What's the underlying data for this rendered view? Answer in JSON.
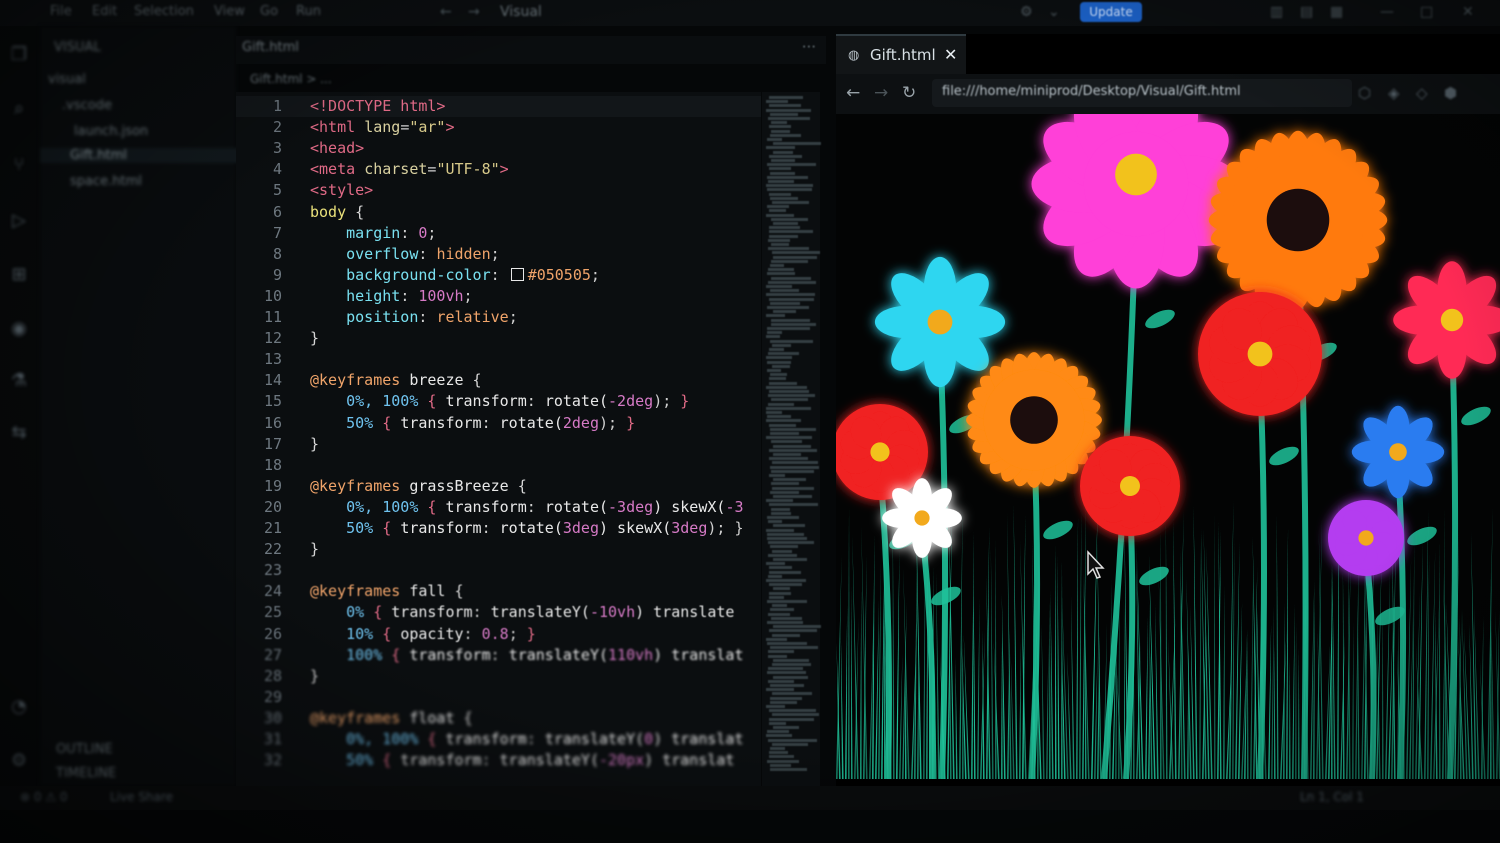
{
  "window": {
    "title": "Visual",
    "menu": [
      "File",
      "Edit",
      "Selection",
      "View",
      "Go",
      "Run"
    ],
    "update_label": "Update"
  },
  "sidebar": {
    "items": [
      {
        "label": "VISUAL"
      },
      {
        "label": "visual"
      },
      {
        "label": ".vscode"
      },
      {
        "label": "launch.json"
      },
      {
        "label": "Gift.html"
      },
      {
        "label": "space.html"
      }
    ],
    "bottom": [
      "OUTLINE",
      "TIMELINE"
    ]
  },
  "editor": {
    "tab_label": "Gift.html",
    "more_label": "···",
    "breadcrumb": "Gift.html > ...",
    "lines": [
      {
        "n": "1",
        "tokens": [
          {
            "t": "<!DOCTYPE html>",
            "c": "tag"
          }
        ]
      },
      {
        "n": "2",
        "tokens": [
          {
            "t": "<html ",
            "c": "tag"
          },
          {
            "t": "lang",
            "c": "attr"
          },
          {
            "t": "=",
            "c": "punc"
          },
          {
            "t": "\"ar\"",
            "c": "str"
          },
          {
            "t": ">",
            "c": "tag"
          }
        ]
      },
      {
        "n": "3",
        "tokens": [
          {
            "t": "<head>",
            "c": "tag"
          }
        ]
      },
      {
        "n": "4",
        "tokens": [
          {
            "t": "<meta ",
            "c": "tag"
          },
          {
            "t": "charset",
            "c": "attr"
          },
          {
            "t": "=",
            "c": "punc"
          },
          {
            "t": "\"UTF-8\"",
            "c": "str"
          },
          {
            "t": ">",
            "c": "tag"
          }
        ]
      },
      {
        "n": "5",
        "tokens": [
          {
            "t": "<style>",
            "c": "tag"
          }
        ]
      },
      {
        "n": "6",
        "tokens": [
          {
            "t": "body",
            "c": "sel"
          },
          {
            "t": " {",
            "c": "brace"
          }
        ]
      },
      {
        "n": "7",
        "tokens": [
          {
            "t": "    margin",
            "c": "prop"
          },
          {
            "t": ": ",
            "c": "punc"
          },
          {
            "t": "0",
            "c": "num"
          },
          {
            "t": ";",
            "c": "punc"
          }
        ]
      },
      {
        "n": "8",
        "tokens": [
          {
            "t": "    overflow",
            "c": "prop"
          },
          {
            "t": ": ",
            "c": "punc"
          },
          {
            "t": "hidden",
            "c": "kw"
          },
          {
            "t": ";",
            "c": "punc"
          }
        ]
      },
      {
        "n": "9",
        "tokens": [
          {
            "t": "    background-color",
            "c": "prop"
          },
          {
            "t": ": ",
            "c": "punc"
          },
          {
            "t": "",
            "c": "swatch"
          },
          {
            "t": "#050505",
            "c": "kw"
          },
          {
            "t": ";",
            "c": "punc"
          }
        ]
      },
      {
        "n": "10",
        "tokens": [
          {
            "t": "    height",
            "c": "prop"
          },
          {
            "t": ": ",
            "c": "punc"
          },
          {
            "t": "100vh",
            "c": "num"
          },
          {
            "t": ";",
            "c": "punc"
          }
        ]
      },
      {
        "n": "11",
        "tokens": [
          {
            "t": "    position",
            "c": "prop"
          },
          {
            "t": ": ",
            "c": "punc"
          },
          {
            "t": "relative",
            "c": "kw"
          },
          {
            "t": ";",
            "c": "punc"
          }
        ]
      },
      {
        "n": "12",
        "tokens": [
          {
            "t": "}",
            "c": "brace"
          }
        ]
      },
      {
        "n": "13",
        "tokens": []
      },
      {
        "n": "14",
        "tokens": [
          {
            "t": "@keyframes ",
            "c": "kw"
          },
          {
            "t": "breeze",
            "c": "val"
          },
          {
            "t": " {",
            "c": "brace"
          }
        ]
      },
      {
        "n": "15",
        "tokens": [
          {
            "t": "    0%, 100%",
            "c": "pct"
          },
          {
            "t": " { ",
            "c": "tag"
          },
          {
            "t": "transform",
            "c": "val"
          },
          {
            "t": ": ",
            "c": "punc"
          },
          {
            "t": "rotate(",
            "c": "fn"
          },
          {
            "t": "-2deg",
            "c": "num"
          },
          {
            "t": "); ",
            "c": "punc"
          },
          {
            "t": "}",
            "c": "tag"
          }
        ]
      },
      {
        "n": "16",
        "tokens": [
          {
            "t": "    50%",
            "c": "pct"
          },
          {
            "t": " { ",
            "c": "tag"
          },
          {
            "t": "transform",
            "c": "val"
          },
          {
            "t": ": ",
            "c": "punc"
          },
          {
            "t": "rotate(",
            "c": "fn"
          },
          {
            "t": "2deg",
            "c": "num"
          },
          {
            "t": "); ",
            "c": "punc"
          },
          {
            "t": "}",
            "c": "tag"
          }
        ]
      },
      {
        "n": "17",
        "tokens": [
          {
            "t": "}",
            "c": "brace"
          }
        ]
      },
      {
        "n": "18",
        "tokens": []
      },
      {
        "n": "19",
        "tokens": [
          {
            "t": "@keyframes ",
            "c": "kw"
          },
          {
            "t": "grassBreeze",
            "c": "val"
          },
          {
            "t": " {",
            "c": "brace"
          }
        ]
      },
      {
        "n": "20",
        "tokens": [
          {
            "t": "    0%, 100%",
            "c": "pct"
          },
          {
            "t": " { ",
            "c": "tag"
          },
          {
            "t": "transform",
            "c": "val"
          },
          {
            "t": ": ",
            "c": "punc"
          },
          {
            "t": "rotate(",
            "c": "fn"
          },
          {
            "t": "-3deg",
            "c": "num"
          },
          {
            "t": ") skewX(",
            "c": "fn"
          },
          {
            "t": "-3",
            "c": "num"
          }
        ]
      },
      {
        "n": "21",
        "tokens": [
          {
            "t": "    50%",
            "c": "pct"
          },
          {
            "t": " { ",
            "c": "tag"
          },
          {
            "t": "transform",
            "c": "val"
          },
          {
            "t": ": ",
            "c": "punc"
          },
          {
            "t": "rotate(",
            "c": "fn"
          },
          {
            "t": "3deg",
            "c": "num"
          },
          {
            "t": ") skewX(",
            "c": "fn"
          },
          {
            "t": "3deg",
            "c": "num"
          },
          {
            "t": "); }",
            "c": "punc"
          }
        ]
      },
      {
        "n": "22",
        "tokens": [
          {
            "t": "}",
            "c": "brace"
          }
        ]
      },
      {
        "n": "23",
        "tokens": []
      },
      {
        "n": "24",
        "tokens": [
          {
            "t": "@keyframes ",
            "c": "kw"
          },
          {
            "t": "fall",
            "c": "val"
          },
          {
            "t": " {",
            "c": "brace"
          }
        ]
      },
      {
        "n": "25",
        "tokens": [
          {
            "t": "    0%",
            "c": "pct"
          },
          {
            "t": " { ",
            "c": "tag"
          },
          {
            "t": "transform",
            "c": "val"
          },
          {
            "t": ": ",
            "c": "punc"
          },
          {
            "t": "translateY(",
            "c": "fn"
          },
          {
            "t": "-10vh",
            "c": "num"
          },
          {
            "t": ") translate",
            "c": "fn"
          }
        ]
      },
      {
        "n": "26",
        "tokens": [
          {
            "t": "    10%",
            "c": "pct"
          },
          {
            "t": " { ",
            "c": "tag"
          },
          {
            "t": "opacity",
            "c": "val"
          },
          {
            "t": ": ",
            "c": "punc"
          },
          {
            "t": "0.8",
            "c": "num"
          },
          {
            "t": "; ",
            "c": "punc"
          },
          {
            "t": "}",
            "c": "tag"
          }
        ]
      },
      {
        "n": "27",
        "tokens": [
          {
            "t": "    100%",
            "c": "pct"
          },
          {
            "t": " { ",
            "c": "tag"
          },
          {
            "t": "transform",
            "c": "val"
          },
          {
            "t": ": ",
            "c": "punc"
          },
          {
            "t": "translateY(",
            "c": "fn"
          },
          {
            "t": "110vh",
            "c": "num"
          },
          {
            "t": ") translat",
            "c": "fn"
          }
        ]
      },
      {
        "n": "28",
        "tokens": [
          {
            "t": "}",
            "c": "brace"
          }
        ]
      },
      {
        "n": "29",
        "tokens": []
      },
      {
        "n": "30",
        "tokens": [
          {
            "t": "@keyframes ",
            "c": "kw"
          },
          {
            "t": "float",
            "c": "val"
          },
          {
            "t": " {",
            "c": "brace"
          }
        ]
      },
      {
        "n": "31",
        "tokens": [
          {
            "t": "    0%, 100%",
            "c": "pct"
          },
          {
            "t": " { ",
            "c": "tag"
          },
          {
            "t": "transform",
            "c": "val"
          },
          {
            "t": ": ",
            "c": "punc"
          },
          {
            "t": "translateY(",
            "c": "fn"
          },
          {
            "t": "0",
            "c": "num"
          },
          {
            "t": ") translat",
            "c": "fn"
          }
        ]
      },
      {
        "n": "32",
        "tokens": [
          {
            "t": "    50%",
            "c": "pct"
          },
          {
            "t": " { ",
            "c": "tag"
          },
          {
            "t": "transform",
            "c": "val"
          },
          {
            "t": ": ",
            "c": "punc"
          },
          {
            "t": "translateY(",
            "c": "fn"
          },
          {
            "t": "-20px",
            "c": "num"
          },
          {
            "t": ") translat",
            "c": "fn"
          }
        ]
      }
    ]
  },
  "browser": {
    "tab_label": "Gift.html",
    "close_icon": "close-icon",
    "address": "file:///home/miniprod/Desktop/Visual/Gift.html",
    "flowers": [
      {
        "color": "#ff3fd8",
        "center": "#f2c21a",
        "kind": "daisy"
      },
      {
        "color": "#ff7a10",
        "center": "#1a0d0a",
        "kind": "sunflower"
      },
      {
        "color": "#2fd6f0",
        "center": "#f2a91a",
        "kind": "star"
      },
      {
        "color": "#ff8a12",
        "center": "#1a0d0a",
        "kind": "sunflower"
      },
      {
        "color": "#f02020",
        "center": "#f2c21a",
        "kind": "round"
      },
      {
        "color": "#f02020",
        "center": "#f2c21a",
        "kind": "round"
      },
      {
        "color": "#f02020",
        "center": "#f2c21a",
        "kind": "round"
      },
      {
        "color": "#ff2a55",
        "center": "#f2c21a",
        "kind": "star"
      },
      {
        "color": "#ffffff",
        "center": "#f2a91a",
        "kind": "star"
      },
      {
        "color": "#2a7cf0",
        "center": "#f2a91a",
        "kind": "star"
      },
      {
        "color": "#b43cf0",
        "center": "#f2a91a",
        "kind": "round"
      }
    ],
    "grass_color": "#1fc29a"
  },
  "statusbar": {
    "left": "⊗ 0 ⚠ 0",
    "branch": "Live Share",
    "right": "Ln 1, Col 1"
  },
  "colors": {
    "accent": "#1c62c9",
    "page_bg": "#050708"
  }
}
